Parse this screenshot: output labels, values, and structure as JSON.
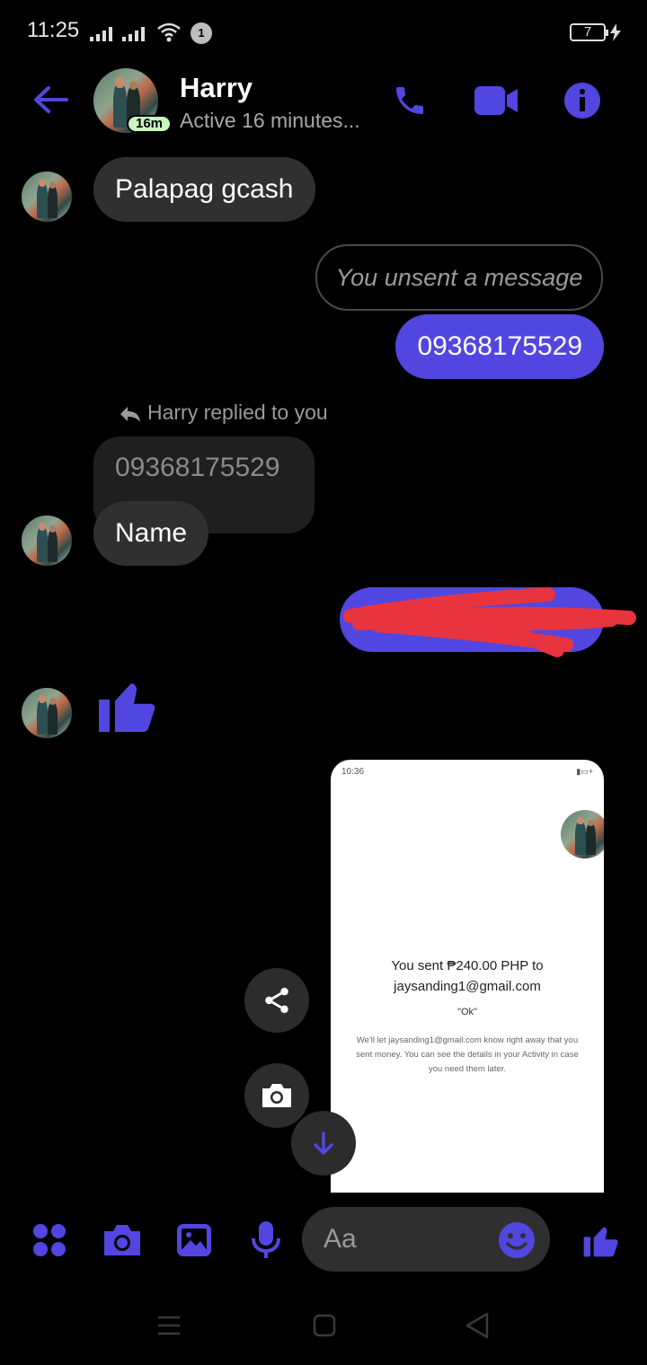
{
  "status_bar": {
    "time": "11:25",
    "notification_count": "1",
    "battery": "7"
  },
  "header": {
    "contact_name": "Harry",
    "active_badge": "16m",
    "status": "Active 16 minutes..."
  },
  "messages": {
    "m1": "Palapag gcash",
    "unsent": "You unsent a message",
    "m2": "09368175529",
    "reply_label": "Harry replied to you",
    "quoted": "09368175529",
    "m3": "Name"
  },
  "shared_screenshot": {
    "time": "10:36",
    "main_line1": "You sent ₱240.00 PHP to",
    "main_line2": "jaysanding1@gmail.com",
    "quote": "\"Ok\"",
    "note": "We'll let jaysanding1@gmail.com know right away that you sent money. You can see the details in your Activity in case you need them later."
  },
  "composer": {
    "placeholder": "Aa"
  },
  "colors": {
    "accent": "#5147e0",
    "background": "#000000",
    "incoming_bubble": "#303030",
    "redaction": "#e8343f"
  },
  "icons": [
    "back-arrow-icon",
    "phone-icon",
    "video-icon",
    "info-icon",
    "reply-icon",
    "thumbs-up-icon",
    "share-icon",
    "camera-icon",
    "arrow-down-icon",
    "apps-icon",
    "image-icon",
    "mic-icon",
    "emoji-icon",
    "menu-nav-icon",
    "home-nav-icon",
    "back-nav-icon"
  ]
}
